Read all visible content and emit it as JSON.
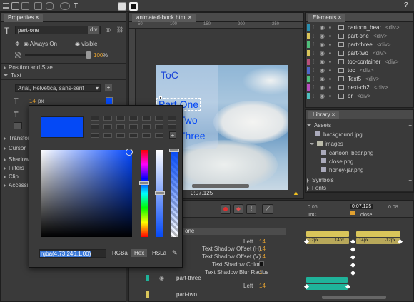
{
  "toolbar": {
    "help_label": "?"
  },
  "properties": {
    "tab": "Properties",
    "element_id": "part-one",
    "element_type": "div",
    "overflow": "Always On",
    "visibility": "visible",
    "opacity": "100",
    "opacity_unit": "%",
    "sections": [
      "Position and Size",
      "Text"
    ],
    "font_family": "Arial, Helvetica, sans-serif",
    "font_size": "14",
    "font_unit": "px",
    "collapsed": [
      "Transfor",
      "Cursor",
      "Shadow",
      "Filters",
      "Clip",
      "Accessib"
    ]
  },
  "stage": {
    "tab": "animated-book.html",
    "ruler_marks": [
      "50",
      "100",
      "150",
      "200",
      "250"
    ],
    "toc": "ToC",
    "parts": [
      "Part One",
      "Two",
      "Three"
    ],
    "time": "0:07.125"
  },
  "color_picker": {
    "value": "rgba(4,73,246,1.00)",
    "modes": [
      "RGBa",
      "Hex",
      "HSLa"
    ],
    "selected_color": "#0449f6"
  },
  "elements": {
    "tab": "Elements",
    "items": [
      {
        "name": "cartoon_bear",
        "type": "<div>",
        "color": "#2a8fb0"
      },
      {
        "name": "part-one",
        "type": "<div>",
        "color": "#d9c55a"
      },
      {
        "name": "part-three",
        "type": "<div>",
        "color": "#4fbf7a"
      },
      {
        "name": "part-two",
        "type": "<div>",
        "color": "#d9c55a"
      },
      {
        "name": "toc-container",
        "type": "<div>",
        "color": "#b84f7a"
      },
      {
        "name": "toc",
        "type": "<div>",
        "color": "#4d67c9"
      },
      {
        "name": "Text5",
        "type": "<div>",
        "color": "#4fbf7a"
      },
      {
        "name": "next-ch2",
        "type": "<div>",
        "color": "#b84fbf"
      },
      {
        "name": "or",
        "type": "<div>",
        "color": "#4fbfbf"
      }
    ]
  },
  "library": {
    "tab": "Library",
    "assets_label": "Assets",
    "assets": [
      "background.jpg"
    ],
    "images_folder": "images",
    "images": [
      "cartoon_bear.png",
      "close.png",
      "honey-jar.png"
    ],
    "symbols_label": "Symbols",
    "fonts_label": "Fonts"
  },
  "timeline": {
    "ticks": [
      "0:06",
      "0:07.125",
      "0:08"
    ],
    "labels": [
      "ToC",
      "close"
    ],
    "top_row": "one",
    "props": [
      {
        "label": "Left",
        "value": "14"
      },
      {
        "label": "Text Shadow Offset (H)",
        "value": "14"
      },
      {
        "label": "Text Shadow Offset (V)",
        "value": "14"
      },
      {
        "label": "Text Shadow Color",
        "value": ""
      },
      {
        "label": "Text Shadow Blur Radius",
        "value": "1"
      }
    ],
    "part_three": "part-three",
    "part_three_left": "Left",
    "part_three_value": "14",
    "part_two": "part-two",
    "key_labels": [
      "-12px",
      "14px",
      "14px",
      "-12px"
    ]
  }
}
